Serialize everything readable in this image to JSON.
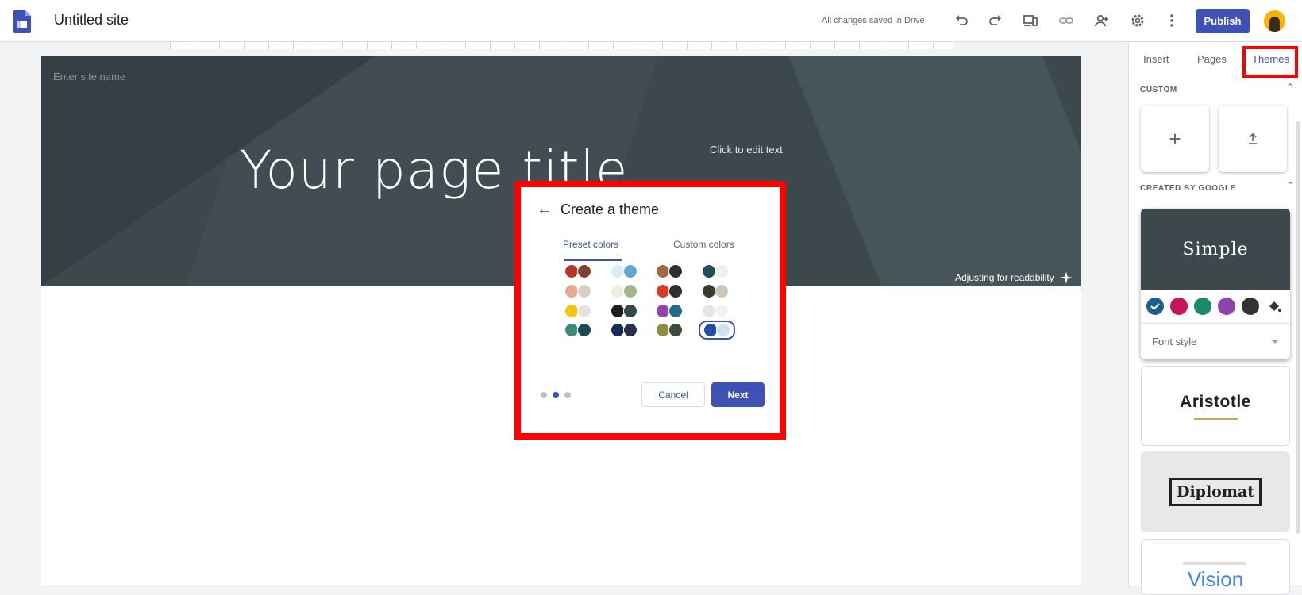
{
  "topbar": {
    "site_title": "Untitled site",
    "save_status": "All changes saved in Drive",
    "publish_label": "Publish"
  },
  "canvas": {
    "site_name_placeholder": "Enter site name",
    "page_title": "Your page title",
    "edit_hint": "Click to edit text",
    "readability_note": "Adjusting for readability"
  },
  "panel": {
    "tabs": [
      "Insert",
      "Pages",
      "Themes"
    ],
    "active_tab": "Themes",
    "custom_label": "CUSTOM",
    "google_label": "CREATED BY GOOGLE",
    "themes": {
      "simple": "Simple",
      "aristotle": "Aristotle",
      "diplomat": "Diplomat",
      "vision": "Vision"
    },
    "simple_swatches": [
      "#1e5f8a",
      "#c2185b",
      "#1b8a6b",
      "#8e44ad",
      "#333333"
    ],
    "font_style_label": "Font style"
  },
  "dialog": {
    "title": "Create a theme",
    "tab_preset": "Preset colors",
    "tab_custom": "Custom colors",
    "cancel_label": "Cancel",
    "next_label": "Next",
    "palettes": [
      [
        "#b23a2a",
        "#7a4332"
      ],
      [
        "#d7eef7",
        "#5fa8d3"
      ],
      [
        "#9c6b45",
        "#2f2f2f"
      ],
      [
        "#1f4e5f",
        "#eef0ea"
      ],
      [
        "#e8a98e",
        "#d5cfc6"
      ],
      [
        "#eaeee2",
        "#a6b48e"
      ],
      [
        "#d93a2a",
        "#2f2f2f"
      ],
      [
        "#3b3b36",
        "#cdc6b9"
      ],
      [
        "#f3c414",
        "#e6e2dc"
      ],
      [
        "#1d1d1d",
        "#37474f"
      ],
      [
        "#8e44ad",
        "#1f6f8b"
      ],
      [
        "#e3e8e6",
        "#f0f3f1"
      ],
      [
        "#3d8b74",
        "#1f4a52"
      ],
      [
        "#1c2a5a",
        "#27304f"
      ],
      [
        "#8e8e3e",
        "#3b4a3a"
      ],
      [
        "#1f4fa6",
        "#cfe3f1"
      ]
    ],
    "selected_palette": 15,
    "step": 2,
    "total_steps": 3
  }
}
